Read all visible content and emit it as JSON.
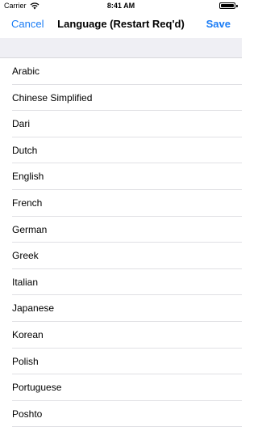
{
  "status_bar": {
    "carrier": "Carrier",
    "time": "8:41 AM",
    "battery_level": 1.0
  },
  "nav": {
    "cancel_label": "Cancel",
    "title": "Language (Restart Req'd)",
    "save_label": "Save",
    "accent_color": "#1a7cf5"
  },
  "languages": [
    "Arabic",
    "Chinese Simplified",
    "Dari",
    "Dutch",
    "English",
    "French",
    "German",
    "Greek",
    "Italian",
    "Japanese",
    "Korean",
    "Polish",
    "Portuguese",
    "Poshto"
  ]
}
